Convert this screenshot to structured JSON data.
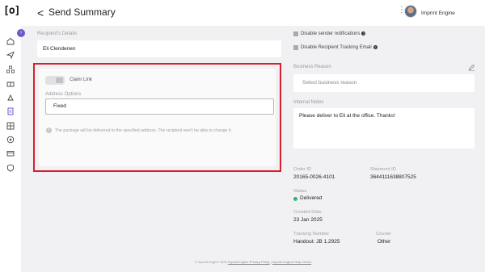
{
  "app": {
    "logo_text": "[o]",
    "title": "Send Summary",
    "back_glyph": "<"
  },
  "header": {
    "more_glyph": "⋮",
    "user_name": "Imprint Engine"
  },
  "recipient": {
    "label": "Recipient's Details",
    "value": "Eli Clendenen"
  },
  "claim": {
    "toggle_label": "Claim Link",
    "address_label": "Address Options",
    "address_value": "Fixed",
    "info_text": "The package will be delivered to the specified address. The recipient won't be able to change it."
  },
  "options": {
    "disable_notifications": "Disable sender notifications",
    "disable_tracking": "Disable Recipient Tracking Email"
  },
  "business_reason": {
    "label": "Business Reason",
    "placeholder": "Select business reason"
  },
  "internal_notes": {
    "label": "Internal Notes",
    "value": "Please deliver to Eli at the office. Thanks!"
  },
  "order": {
    "order_id_label": "Order ID",
    "order_id": "20165-0026-4101",
    "shipment_id_label": "Shipment ID",
    "shipment_id": "3644111638807525",
    "status_label": "Status",
    "status": "Delivered",
    "status_color": "#2bb673",
    "created_label": "Created Date",
    "created": "23 Jan 2025",
    "tracking_label": "Tracking Number",
    "tracking": "Handout: JB 1.2925",
    "courier_label": "Courier",
    "courier": "Other"
  },
  "footer": {
    "copyright": "© Imprint Engine 2025",
    "privacy": "Imprint Engine Privacy Policy",
    "help": "Imprint Engine Help Center"
  },
  "nav_icons": [
    "home-icon",
    "send-icon",
    "org-icon",
    "gift-icon",
    "rocket-icon",
    "orders-icon",
    "catalog-icon",
    "integrations-icon",
    "wallet-icon",
    "settings-icon"
  ],
  "colors": {
    "accent": "#6a5acd",
    "highlight_border": "#d5202f",
    "panel_bg": "#f1f1f3"
  }
}
